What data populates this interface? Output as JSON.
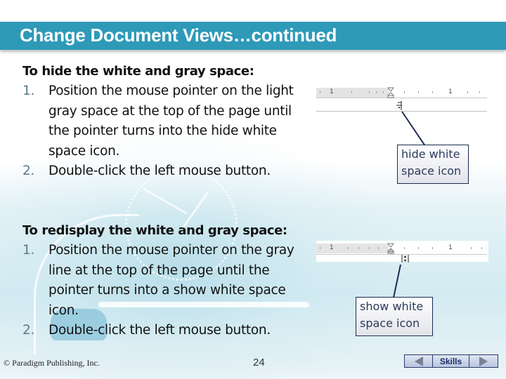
{
  "slide": {
    "title": "Change Document Views…continued",
    "colors": {
      "title_bar": "#2e9ab8",
      "callout_border": "#1e2a52",
      "callout_text": "#2d3a5e",
      "step_number": "#5a7a8c"
    }
  },
  "hide_section": {
    "heading": "To hide the white and gray space:",
    "steps": [
      {
        "num": "1.",
        "text": "Position the mouse pointer on the light gray space at the top of the page until the pointer turns into the hide white space icon."
      },
      {
        "num": "2.",
        "text": "Double-click the left mouse button."
      }
    ],
    "ruler": {
      "marks": [
        "1",
        "1"
      ],
      "cursor_icon": "hide-white-space-cursor"
    },
    "callout": "hide white space icon"
  },
  "show_section": {
    "heading": "To redisplay the white and gray space:",
    "steps": [
      {
        "num": "1.",
        "text": "Position the mouse pointer on the gray line at the top of the page until the pointer turns into a show white space icon."
      },
      {
        "num": "2.",
        "text": "Double-click the left mouse button."
      }
    ],
    "ruler": {
      "marks": [
        "1",
        "1"
      ],
      "cursor_icon": "show-white-space-cursor"
    },
    "callout": "show white space icon"
  },
  "footer": {
    "copyright": "© Paradigm Publishing, Inc.",
    "page_number": "24",
    "nav": {
      "prev_icon": "triangle-left-icon",
      "skills_label": "Skills",
      "next_icon": "triangle-right-icon"
    }
  }
}
